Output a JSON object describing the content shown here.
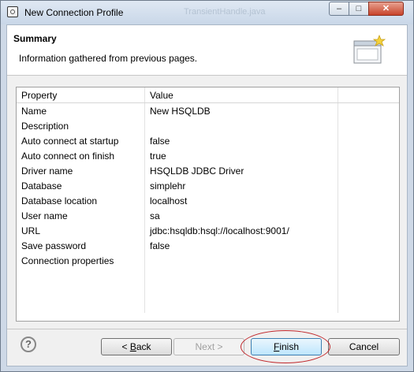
{
  "window": {
    "title": "New Connection Profile",
    "ghost_title": "TransientHandle.java",
    "controls": {
      "minimize": "–",
      "maximize": "□",
      "close": "✕"
    }
  },
  "banner": {
    "title": "Summary",
    "description": "Information gathered from previous pages."
  },
  "table": {
    "headers": [
      "Property",
      "Value",
      ""
    ],
    "rows": [
      {
        "property": "Name",
        "value": "New HSQLDB"
      },
      {
        "property": "Description",
        "value": ""
      },
      {
        "property": "Auto connect at startup",
        "value": "false"
      },
      {
        "property": "Auto connect on finish",
        "value": "true"
      },
      {
        "property": "Driver name",
        "value": "HSQLDB JDBC Driver"
      },
      {
        "property": "Database",
        "value": "simplehr"
      },
      {
        "property": "Database location",
        "value": "localhost"
      },
      {
        "property": "User name",
        "value": "sa"
      },
      {
        "property": "URL",
        "value": "jdbc:hsqldb:hsql://localhost:9001/"
      },
      {
        "property": "Save password",
        "value": "false"
      },
      {
        "property": "Connection properties",
        "value": ""
      }
    ]
  },
  "footer": {
    "help": "?",
    "back_prefix": "< ",
    "back_mnemonic": "B",
    "back_rest": "ack",
    "next": "Next >",
    "finish_mnemonic": "F",
    "finish_rest": "inish",
    "cancel": "Cancel"
  },
  "colors": {
    "highlight_ellipse": "#c0262a",
    "default_button_border": "#3c7fb1"
  }
}
